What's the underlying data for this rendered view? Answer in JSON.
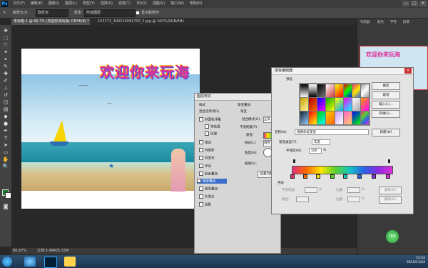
{
  "app": {
    "logo": "Ps",
    "window_controls": [
      "—",
      "▢",
      "✕"
    ]
  },
  "menubar": [
    "文件(F)",
    "编辑(E)",
    "图像(I)",
    "图层(L)",
    "类型(Y)",
    "选择(S)",
    "滤镜(T)",
    "3D(D)",
    "视图(V)",
    "窗口(W)",
    "帮助(H)"
  ],
  "options": {
    "label_size": "取样大小:",
    "size_value": "取样点",
    "label_sample": "样本:",
    "sample_value": "所有图层",
    "show_ring": "显示取样环"
  },
  "tabs": [
    {
      "label": "未标题-1 @ 66.7% (欢迎你来玩海, CMYK/8) *",
      "active": true
    },
    {
      "label": "153272_190219091703_2.jpg @ 100%(RGB/8#)",
      "active": false
    }
  ],
  "doc": {
    "banner": "欢迎你来玩海"
  },
  "status": {
    "zoom": "66.67%",
    "doc": "文档:5.49M/5.33M"
  },
  "right_panel": {
    "tabs": [
      "导航器",
      "颜色",
      "字符",
      "段落"
    ],
    "thumb_text": "欢迎你来玩海"
  },
  "layer_style": {
    "title": "图层样式",
    "items": [
      {
        "label": "样式",
        "checkbox": false
      },
      {
        "label": "混合选项:默认",
        "checkbox": false
      },
      {
        "label": "斜面和浮雕",
        "checkbox": true
      },
      {
        "label": "等高线",
        "checkbox": true
      },
      {
        "label": "纹理",
        "checkbox": true
      },
      {
        "label": "描边",
        "checkbox": true
      },
      {
        "label": "内阴影",
        "checkbox": true
      },
      {
        "label": "内发光",
        "checkbox": true
      },
      {
        "label": "光泽",
        "checkbox": true
      },
      {
        "label": "颜色叠加",
        "checkbox": true
      },
      {
        "label": "渐变叠加",
        "checkbox": true,
        "checked": true
      },
      {
        "label": "图案叠加",
        "checkbox": true
      },
      {
        "label": "外发光",
        "checkbox": true
      },
      {
        "label": "投影",
        "checkbox": true
      }
    ],
    "section": "渐变叠加",
    "sub": "渐变",
    "blend_mode": "混合模式(O):",
    "blend_value": "正常",
    "opacity": "不透明度(P):",
    "gradient": "渐变:",
    "style": "样式(L):",
    "style_value": "线性",
    "angle": "角度(N):",
    "scale": "缩放(S):",
    "default_btn": "设置为默认值"
  },
  "gradient_editor": {
    "title": "渐变编辑器",
    "presets_label": "预设",
    "buttons": [
      "确定",
      "取消",
      "载入(L)...",
      "存储(S)..."
    ],
    "name_label": "名称(N):",
    "name_value": "透明彩虹渐变",
    "new_btn": "新建(W)",
    "type_label": "渐变类型(T):",
    "type_value": "实底",
    "smooth_label": "平滑度(M):",
    "smooth_value": "100",
    "smooth_unit": "%",
    "stops_label": "色标",
    "opacity_label": "不透明度:",
    "pos_label": "位置:",
    "delete_btn": "删除(D)",
    "color_label": "颜色:",
    "unit": "%"
  },
  "taskbar": {
    "time": "15:54",
    "date": "2015/11/24"
  }
}
